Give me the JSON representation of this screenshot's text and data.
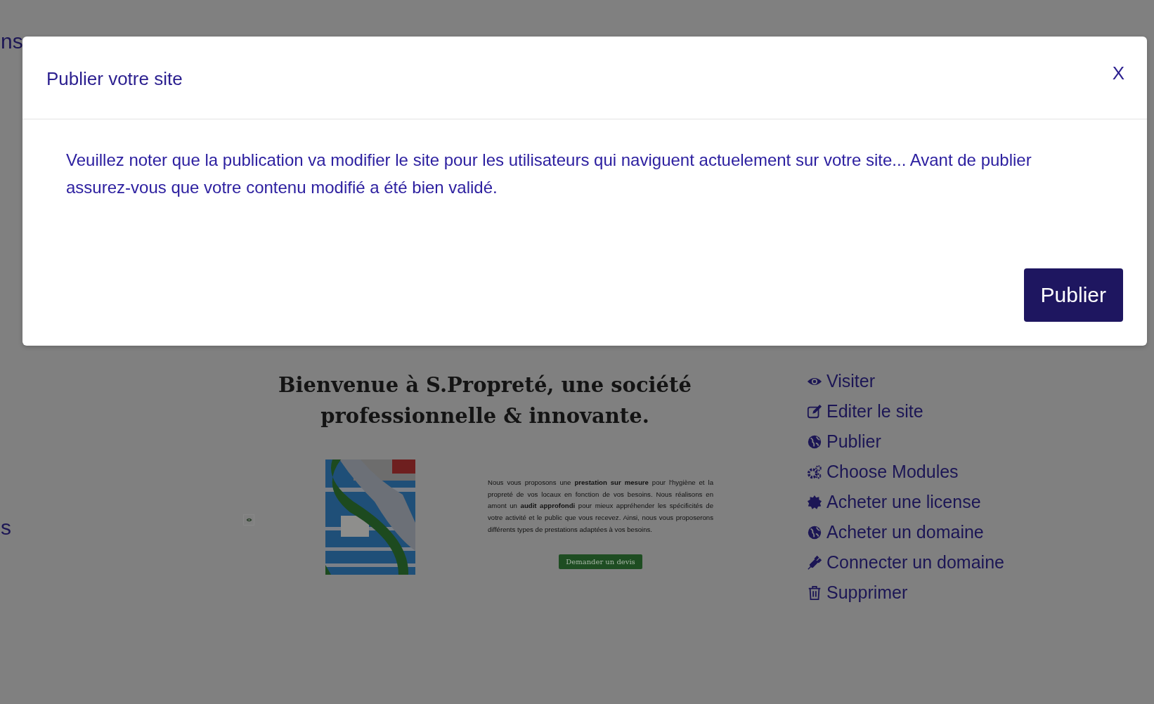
{
  "background_page": {
    "nav_fragment": "ns",
    "side_fragment": "s",
    "heading": "Bienvenue à S.Propreté, une société professionnelle & innovante.",
    "paragraph": "Nous vous proposons une **prestation sur mesure** pour l'hygiène et la propreté de vos locaux en fonction de vos besoins. Nous réalisons en amont un **audit approfondi** pour mieux appréhender les spécificités de votre activité et le public que vous recevez. Ainsi, nous vous proposerons différents types de prestations adaptées à  vos besoins.",
    "quote_button": "Demander un devis",
    "site_menu": [
      "Visiter",
      "Editer le site",
      "Publier",
      "Choose Modules",
      "Acheter une license",
      "Acheter un domaine",
      "Connecter un domaine",
      "Supprimer"
    ]
  },
  "modal": {
    "title": "Publier votre site",
    "close": "X",
    "message": "Veuillez noter que la publication va modifier le site pour les utilisateurs qui naviguent actuelement sur votre site... Avant de publier assurez-vous que votre contenu modifié a été bien validé.",
    "button": "Publier"
  }
}
